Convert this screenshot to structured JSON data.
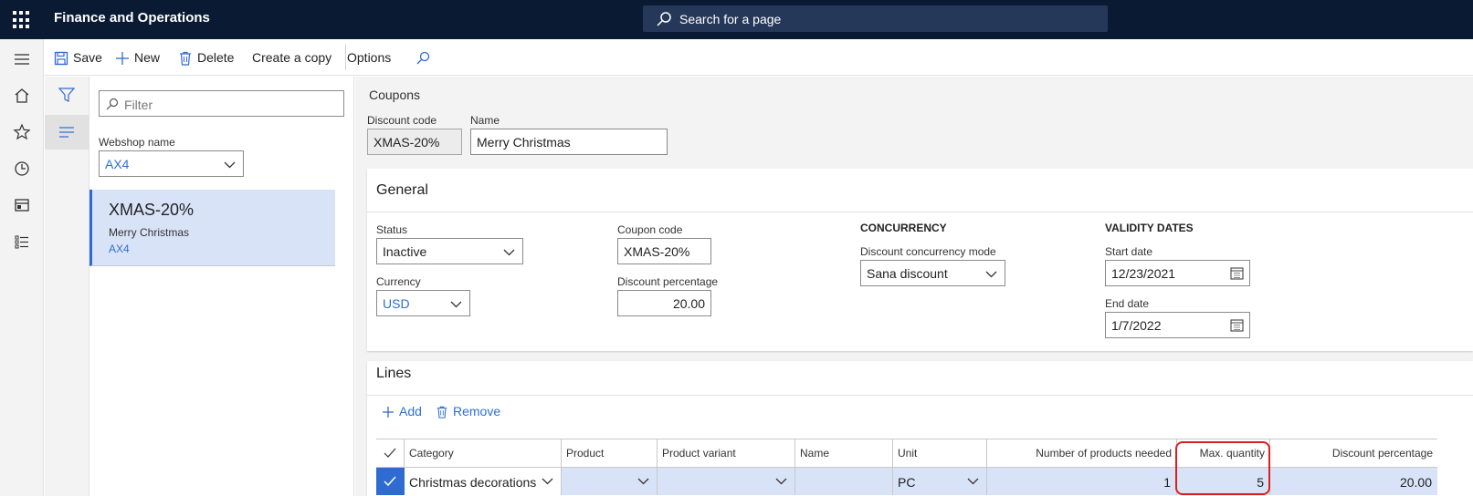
{
  "app": {
    "title": "Finance and Operations",
    "search_placeholder": "Search for a page"
  },
  "nav_icons": [
    "menu-icon",
    "home-icon",
    "star-icon",
    "clock-icon",
    "workspace-icon",
    "list-icon"
  ],
  "toolbar": {
    "save": "Save",
    "new": "New",
    "delete": "Delete",
    "copy": "Create a copy",
    "options": "Options"
  },
  "list_pane": {
    "filter_placeholder": "Filter",
    "webshop_label": "Webshop name",
    "webshop_value": "AX4",
    "items": [
      {
        "code": "XMAS-20%",
        "name": "Merry Christmas",
        "webshop": "AX4"
      }
    ]
  },
  "form": {
    "caption": "Coupons",
    "discount_code_label": "Discount code",
    "discount_code": "XMAS-20%",
    "name_label": "Name",
    "name": "Merry Christmas"
  },
  "general": {
    "title": "General",
    "status_label": "Status",
    "status": "Inactive",
    "currency_label": "Currency",
    "currency": "USD",
    "coupon_code_label": "Coupon code",
    "coupon_code": "XMAS-20%",
    "discount_pct_label": "Discount percentage",
    "discount_pct": "20.00",
    "concurrency_heading": "CONCURRENCY",
    "concurrency_mode_label": "Discount concurrency mode",
    "concurrency_mode": "Sana discount",
    "validity_heading": "VALIDITY DATES",
    "start_label": "Start date",
    "start_date": "12/23/2021",
    "end_label": "End date",
    "end_date": "1/7/2022"
  },
  "lines": {
    "title": "Lines",
    "add": "Add",
    "remove": "Remove",
    "columns": [
      "Category",
      "Product",
      "Product variant",
      "Name",
      "Unit",
      "Number of products needed",
      "Max. quantity",
      "Discount percentage"
    ],
    "rows": [
      {
        "category": "Christmas decorations",
        "product": "",
        "variant": "",
        "name": "",
        "unit": "PC",
        "needed": "1",
        "max_qty": "5",
        "discount": "20.00"
      }
    ]
  },
  "colors": {
    "topbar": "#0a1a33",
    "accent": "#2f6bd1",
    "selection": "#d8e3f8",
    "highlight": "#d9201e"
  }
}
